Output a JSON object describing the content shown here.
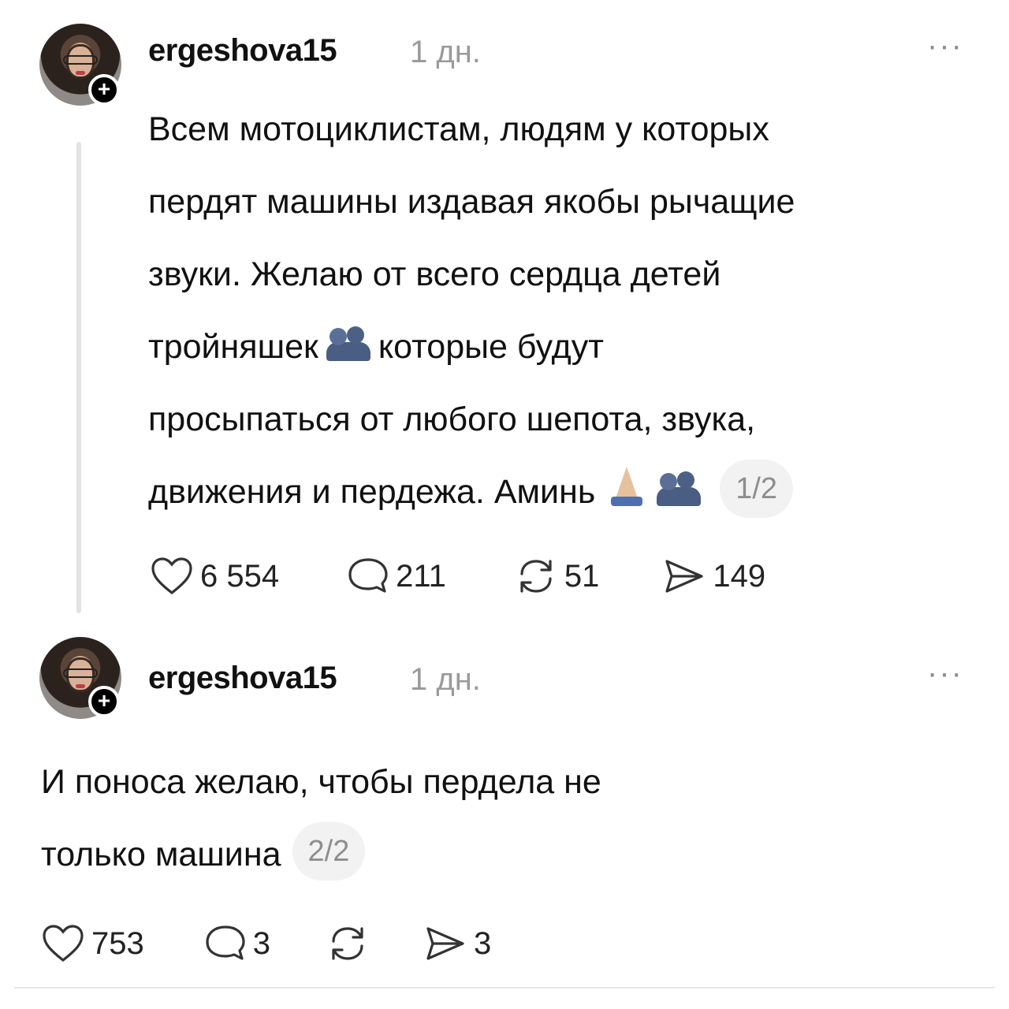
{
  "posts": [
    {
      "username": "ergeshova15",
      "time": "1 дн.",
      "more": "···",
      "lines": [
        "Всем мотоциклистам, людям у которых",
        "пердят машины издавая якобы рычащие",
        "звуки. Желаю от всего сердца детей",
        "тройняшек",
        "которые будут",
        "просыпаться от любого шепота, звука,",
        "движения и пердежа. Аминь"
      ],
      "page": "1/2",
      "likes": "6 554",
      "comments": "211",
      "reposts": "51",
      "shares": "149"
    },
    {
      "username": "ergeshova15",
      "time": "1 дн.",
      "more": "···",
      "lines": [
        "И поноса желаю, чтобы пердела не",
        "только машина"
      ],
      "page": "2/2",
      "likes": "753",
      "comments": "3",
      "reposts": "",
      "shares": "3"
    }
  ],
  "icons": {
    "avatar_badge": "+",
    "emoji_people": "people-hugging",
    "emoji_pray": "folded-hands"
  }
}
